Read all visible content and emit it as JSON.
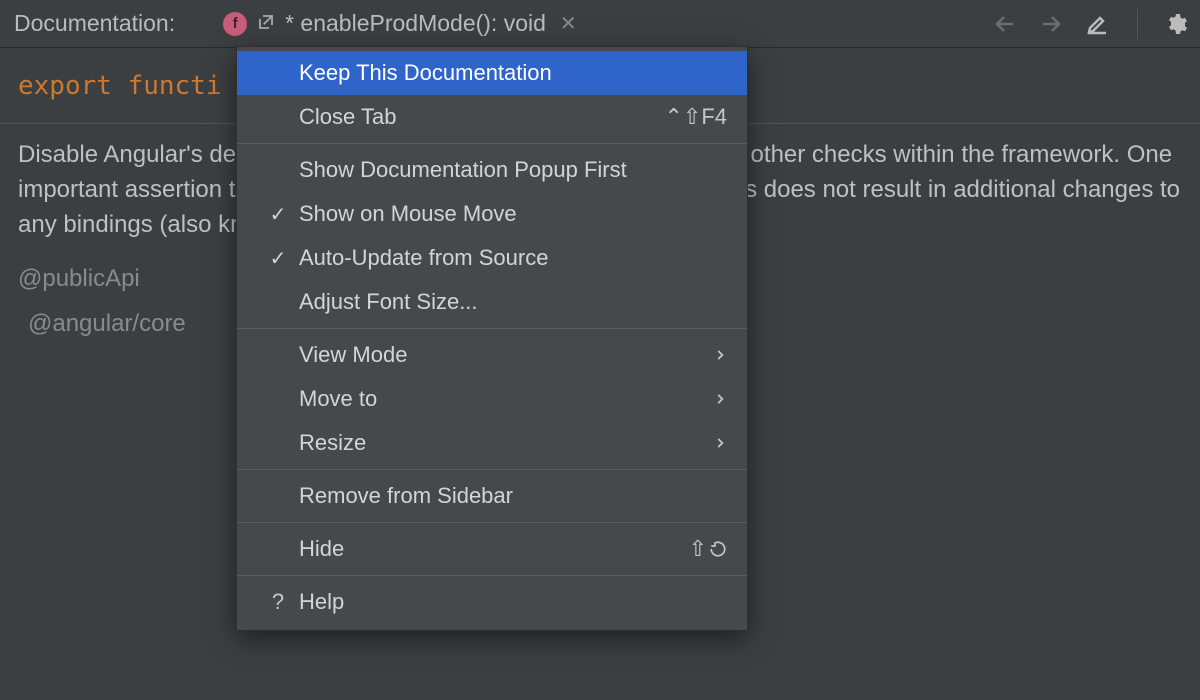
{
  "header": {
    "title": "Documentation:",
    "tab": {
      "label": "* enableProdMode(): void"
    }
  },
  "signature": {
    "kw1": "export",
    "kw2": "functi"
  },
  "body": {
    "paragraph": "Disable Angular's development mode, which turns off assertions and other checks within the framework. One important assertion this disables verifies that a change detection pass does not result in additional changes to any bindings (also known as unidirectional data flow).",
    "annotation": "@publicApi",
    "package": "@angular/core"
  },
  "menu": {
    "items": {
      "keep": "Keep This Documentation",
      "close": "Close Tab",
      "closeShortcut": "⌃⇧F4",
      "popupFirst": "Show Documentation Popup First",
      "mouseMove": "Show on Mouse Move",
      "autoUpdate": "Auto-Update from Source",
      "fontSize": "Adjust Font Size...",
      "viewMode": "View Mode",
      "moveTo": "Move to",
      "resize": "Resize",
      "removeSidebar": "Remove from Sidebar",
      "hide": "Hide",
      "hideShortcut": "⇧",
      "help": "Help"
    }
  }
}
